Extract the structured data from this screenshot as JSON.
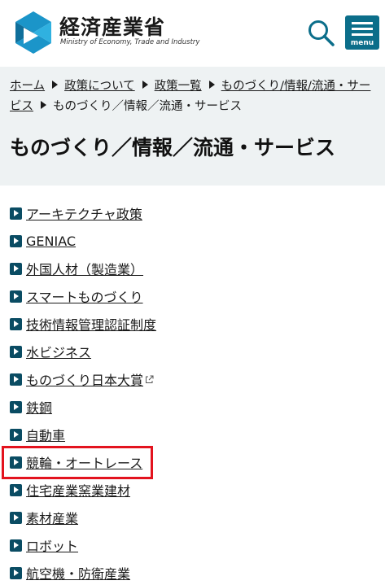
{
  "header": {
    "title_ja": "経済産業省",
    "title_en": "Ministry of Economy, Trade and Industry",
    "logo_icon": "meti-logo-icon",
    "search_icon": "search-icon",
    "menu_label": "menu",
    "menu_color": "#0b6e8a"
  },
  "breadcrumb": [
    {
      "label": "ホーム"
    },
    {
      "label": "政策について"
    },
    {
      "label": "政策一覧"
    },
    {
      "label": "ものづくり/情報/流通・サービス"
    },
    {
      "label": "ものづくり／情報／流通・サービス"
    }
  ],
  "page_title": "ものづくり／情報／流通・サービス",
  "links": [
    {
      "label": "アーキテクチャ政策"
    },
    {
      "label": "GENIAC"
    },
    {
      "label": "外国人材（製造業）"
    },
    {
      "label": "スマートものづくり"
    },
    {
      "label": "技術情報管理認証制度"
    },
    {
      "label": "水ビジネス"
    },
    {
      "label": "ものづくり日本大賞",
      "external": true
    },
    {
      "label": "鉄鋼"
    },
    {
      "label": "自動車"
    },
    {
      "label": "競輪・オートレース",
      "highlighted": true
    },
    {
      "label": "住宅産業窯業建材"
    },
    {
      "label": "素材産業"
    },
    {
      "label": "ロボット"
    },
    {
      "label": "航空機・防衛産業"
    }
  ],
  "colors": {
    "accent": "#0a4c63",
    "band_background": "#eef2f3",
    "highlight_border": "#e3131e"
  }
}
